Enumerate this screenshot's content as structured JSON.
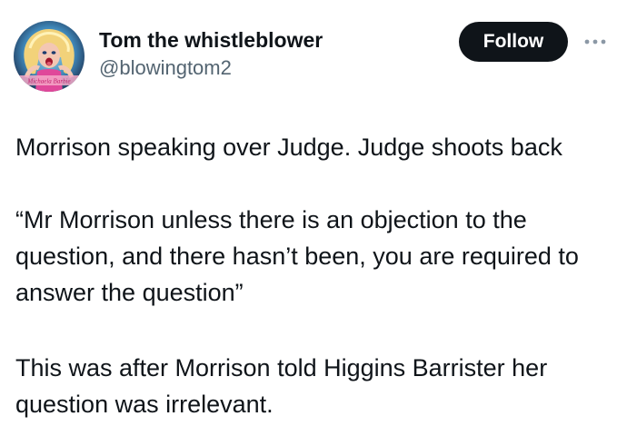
{
  "author": {
    "display_name": "Tom the whistleblower",
    "handle": "@blowingtom2",
    "avatar_icon": "profile-avatar-icon",
    "avatar_banner_text": "Michaela Barbie"
  },
  "actions": {
    "follow_label": "Follow",
    "more_icon": "more-options-icon"
  },
  "tweet": {
    "paragraphs": [
      "Morrison speaking over Judge. Judge shoots back",
      "“Mr Morrison unless there is an objection to the question, and there hasn’t been, you are required to answer the question”",
      "This was after Morrison told Higgins Barrister her question was irrelevant."
    ]
  },
  "colors": {
    "text": "#0f1419",
    "secondary_text": "#536471",
    "button_bg": "#0f1419",
    "button_text": "#ffffff",
    "background": "#ffffff"
  }
}
